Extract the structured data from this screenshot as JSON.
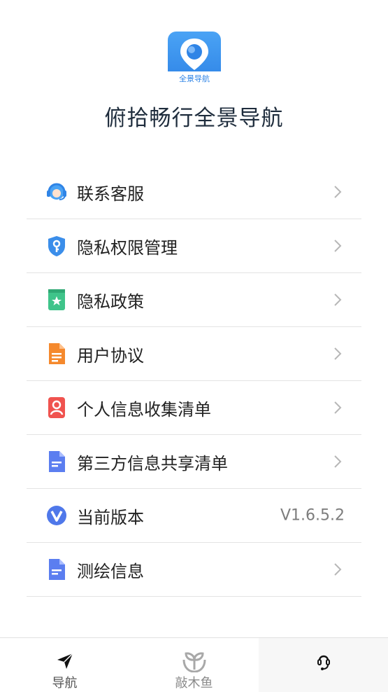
{
  "app": {
    "logo_text": "全景导航",
    "title": "俯拾畅行全景导航",
    "brand_color": "#3b8eea"
  },
  "menu": [
    {
      "label": "联系客服",
      "icon": "headset-icon"
    },
    {
      "label": "隐私权限管理",
      "icon": "shield-key-icon"
    },
    {
      "label": "隐私政策",
      "icon": "bookmark-star-icon"
    },
    {
      "label": "用户协议",
      "icon": "document-orange-icon"
    },
    {
      "label": "个人信息收集清单",
      "icon": "person-card-icon"
    },
    {
      "label": "第三方信息共享清单",
      "icon": "document-blue-icon"
    },
    {
      "label": "当前版本",
      "icon": "v-badge-icon",
      "value": "V1.6.5.2"
    },
    {
      "label": "测绘信息",
      "icon": "document-blue-icon"
    }
  ],
  "tabs": [
    {
      "label": "导航",
      "icon": "navigation-arrow-icon"
    },
    {
      "label": "敲木鱼",
      "icon": "wooden-fish-icon"
    },
    {
      "label": "",
      "icon": "headset-outline-icon"
    }
  ]
}
